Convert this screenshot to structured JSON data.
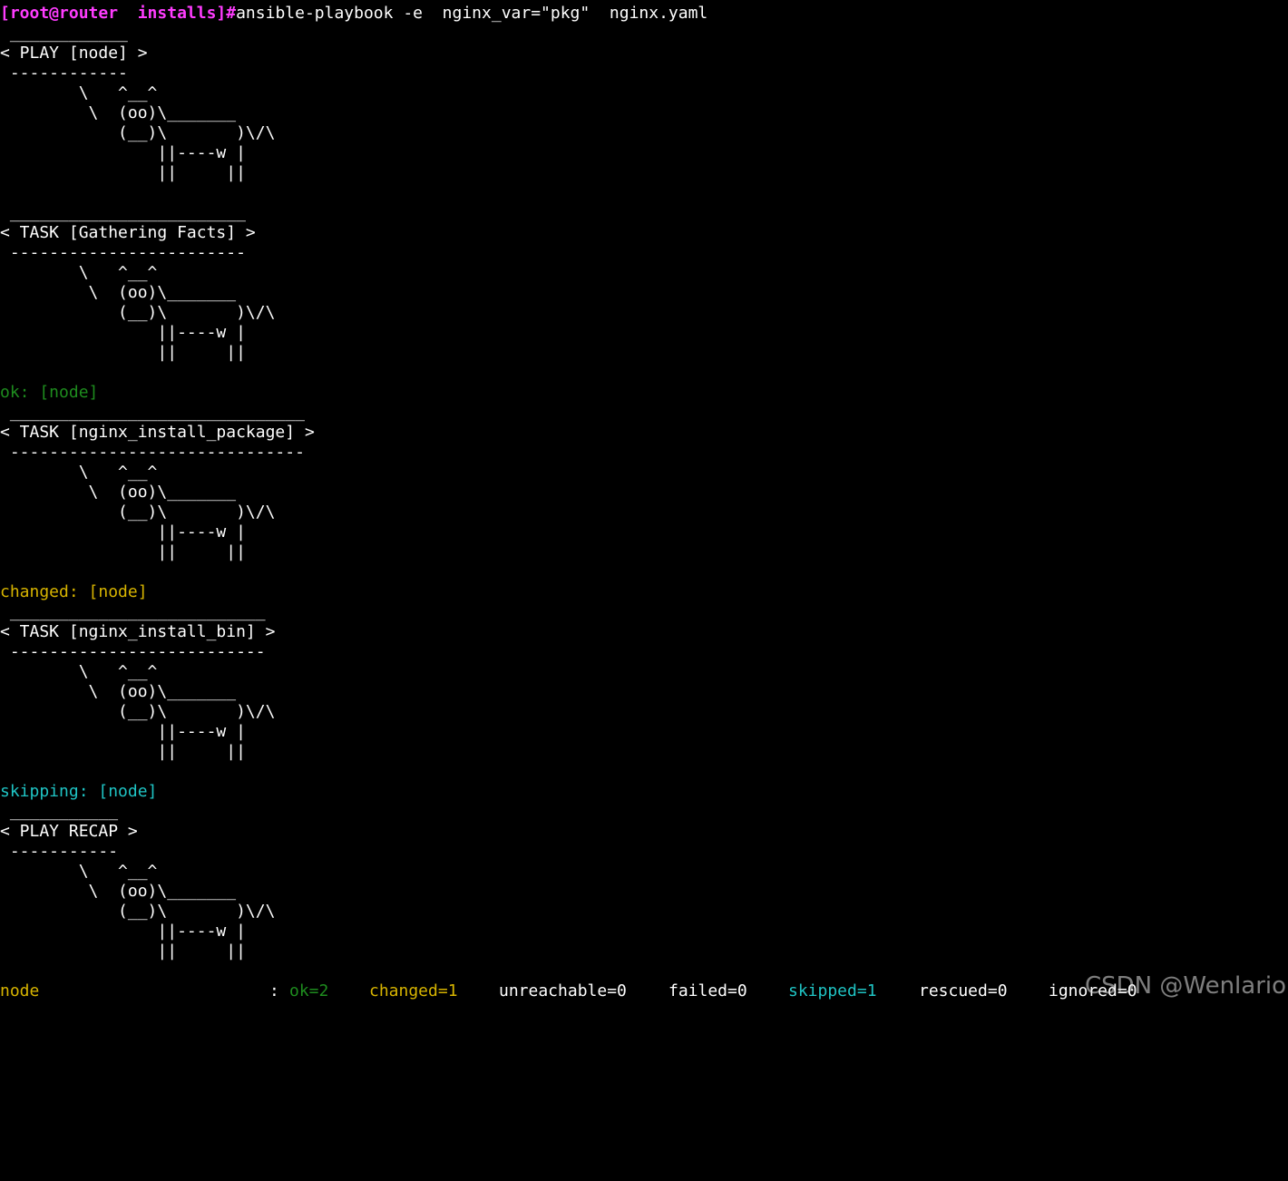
{
  "colors": {
    "background": "#000000",
    "foreground": "#ffffff",
    "prompt": "#ff3cff",
    "ok": "#1e8c1e",
    "changed": "#d7b400",
    "skipping": "#1fc4c4"
  },
  "prompt": {
    "text": "[root@router  installs]#",
    "command": "ansible-playbook -e  nginx_var=\"pkg\"  nginx.yaml"
  },
  "cow": {
    "l1": "        \\   ^__^",
    "l2": "         \\  (oo)\\_______",
    "l3": "            (__)\\       )\\/\\",
    "l4": "                ||----w |",
    "l5": "                ||     ||"
  },
  "blocks": [
    {
      "top": " ____________",
      "title": "< PLAY [node] >",
      "bottom": " ------------"
    },
    {
      "top": " ________________________",
      "title": "< TASK [Gathering Facts] >",
      "bottom": " ------------------------"
    },
    {
      "top": " ______________________________",
      "title": "< TASK [nginx_install_package] >",
      "bottom": " ------------------------------"
    },
    {
      "top": " __________________________",
      "title": "< TASK [nginx_install_bin] >",
      "bottom": " --------------------------"
    },
    {
      "top": " ___________",
      "title": "< PLAY RECAP >",
      "bottom": " -----------"
    }
  ],
  "results": {
    "gathering": "ok: [node]",
    "install_package": "changed: [node]",
    "install_bin": "skipping: [node]"
  },
  "recap": {
    "host": "node",
    "colon": ":",
    "ok": "ok=2",
    "changed": "changed=1",
    "unreachable": "unreachable=0",
    "failed": "failed=0",
    "skipped": "skipped=1",
    "rescued": "rescued=0",
    "ignored": "ignored=0"
  },
  "watermark": "CSDN @Wenlarion"
}
